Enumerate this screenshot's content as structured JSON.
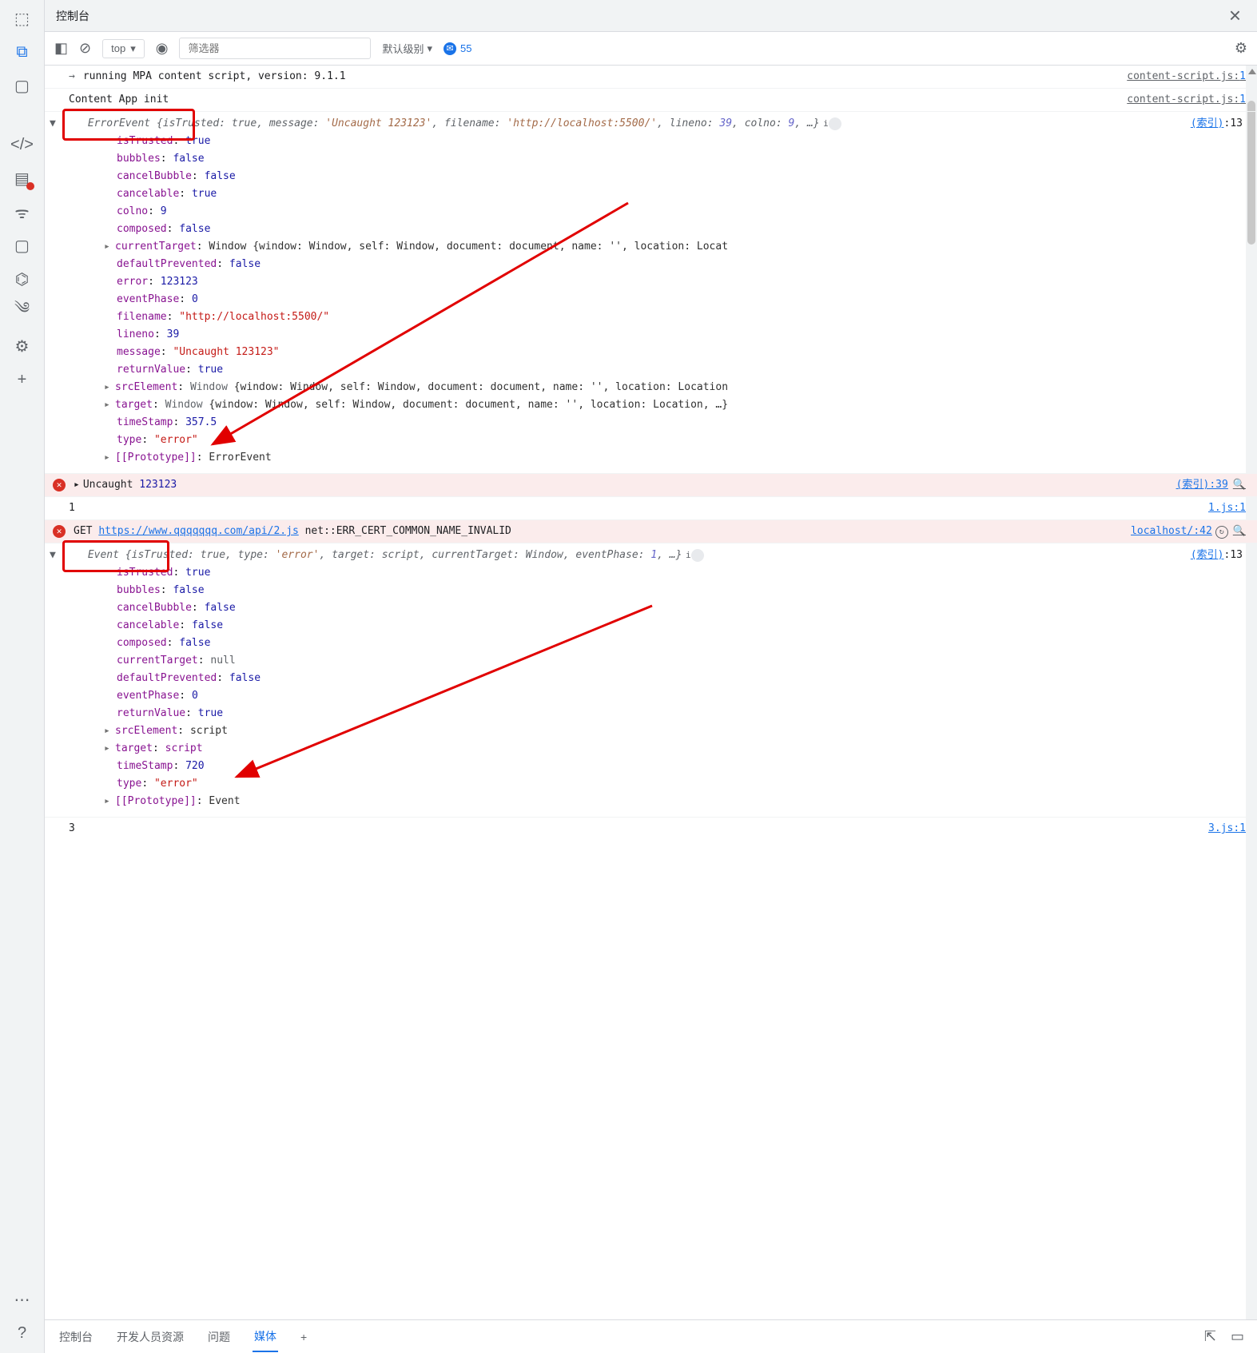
{
  "titlebar": {
    "title": "控制台",
    "close": "×"
  },
  "toolbar": {
    "context": "top",
    "filter_ph": "筛选器",
    "level": "默认级别",
    "msg_count": "55"
  },
  "rows": {
    "r1": {
      "arrow": "→",
      "text": "running MPA content script, version: 9.1.1",
      "src": "content-script.js:",
      "srcn": "1"
    },
    "r2": {
      "text": "Content App init",
      "src": "content-script.js:",
      "srcn": "1"
    }
  },
  "obj1": {
    "src": "(索引)",
    "srcn": ":13",
    "cls": "ErrorEvent",
    "summary_pre": "isTrusted:",
    "summary_t": "true",
    "summary_msg": ", message: ",
    "summary_msgv": "'Uncaught 123123'",
    "summary_fn": ", filename: ",
    "summary_fnv": "'http://localhost:5500/'",
    "summary_ln": ", lineno: ",
    "summary_lnv": "39",
    "summary_cn": ", colno: ",
    "summary_cnv": "9",
    "summary_tail": ", …}",
    "p_isTrusted": "isTrusted",
    "v_isTrusted": "true",
    "p_bubbles": "bubbles",
    "v_bubbles": "false",
    "p_cancelBubble": "cancelBubble",
    "v_cancelBubble": "false",
    "p_cancelable": "cancelable",
    "v_cancelable": "true",
    "p_colno": "colno",
    "v_colno": "9",
    "p_composed": "composed",
    "v_composed": "false",
    "p_currentTarget": "currentTarget",
    "v_currentTarget": "Window {window: Window, self: Window, document: document, name: '', location: Locat",
    "p_defaultPrevented": "defaultPrevented",
    "v_defaultPrevented": "false",
    "p_error": "error",
    "v_error": "123123",
    "p_eventPhase": "eventPhase",
    "v_eventPhase": "0",
    "p_filename": "filename",
    "v_filename": "\"http://localhost:5500/\"",
    "p_lineno": "lineno",
    "v_lineno": "39",
    "p_message": "message",
    "v_message": "\"Uncaught 123123\"",
    "p_returnValue": "returnValue",
    "v_returnValue": "true",
    "p_srcElement": "srcElement",
    "v_srcElement": "Window {window: Window, self: Window, document: document, name: '', location: Location",
    "p_target": "target",
    "v_targetW": "Window",
    "v_target": " {window: Window, self: Window, document: document, name: '', location: Location, …}",
    "p_timeStamp": "timeStamp",
    "v_timeStamp": "357.5",
    "p_type": "type",
    "v_type": "\"error\"",
    "p_proto": "[[Prototype]]",
    "v_proto": "ErrorEvent"
  },
  "err1": {
    "text": "Uncaught",
    "val": "123123",
    "src": "(索引):",
    "srcn": "39"
  },
  "row_1": {
    "text": "1",
    "src": "1.js:",
    "srcn": "1"
  },
  "err2": {
    "method": "GET",
    "url": "https://www.qqqqqqq.com/api/2.js",
    "tail": " net::ERR_CERT_COMMON_NAME_INVALID",
    "src": "localhost/:",
    "srcn": "42"
  },
  "obj2": {
    "src": "(索引)",
    "srcn": ":13",
    "cls": "Event",
    "summary": " {isTrusted: ",
    "s_t": "true",
    "s2": ", type: ",
    "s_tp": "'error'",
    "s3": ", target: ",
    "s_tg": "script",
    "s4": ", currentTarget: ",
    "s_ct": "Window",
    "s5": ", eventPhase: ",
    "s_ep": "1",
    "s6": ", …}",
    "p_isTrusted": "isTrusted",
    "v_isTrusted": "true",
    "p_bubbles": "bubbles",
    "v_bubbles": "false",
    "p_cancelBubble": "cancelBubble",
    "v_cancelBubble": "false",
    "p_cancelable": "cancelable",
    "v_cancelable": "false",
    "p_composed": "composed",
    "v_composed": "false",
    "p_currentTarget": "currentTarget",
    "v_currentTarget": "null",
    "p_defaultPrevented": "defaultPrevented",
    "v_defaultPrevented": "false",
    "p_eventPhase": "eventPhase",
    "v_eventPhase": "0",
    "p_returnValue": "returnValue",
    "v_returnValue": "true",
    "p_srcElement": "srcElement",
    "v_srcElement": "script",
    "p_target": "target",
    "v_target": "script",
    "p_timeStamp": "timeStamp",
    "v_timeStamp": "720",
    "p_type": "type",
    "v_type": "\"error\"",
    "p_proto": "[[Prototype]]",
    "v_proto": "Event"
  },
  "row_3": {
    "text": "3",
    "src": "3.js:",
    "srcn": "1"
  },
  "btabs": {
    "t1": "控制台",
    "t2": "开发人员资源",
    "t3": "问题",
    "t4": "媒体",
    "plus": "+"
  }
}
